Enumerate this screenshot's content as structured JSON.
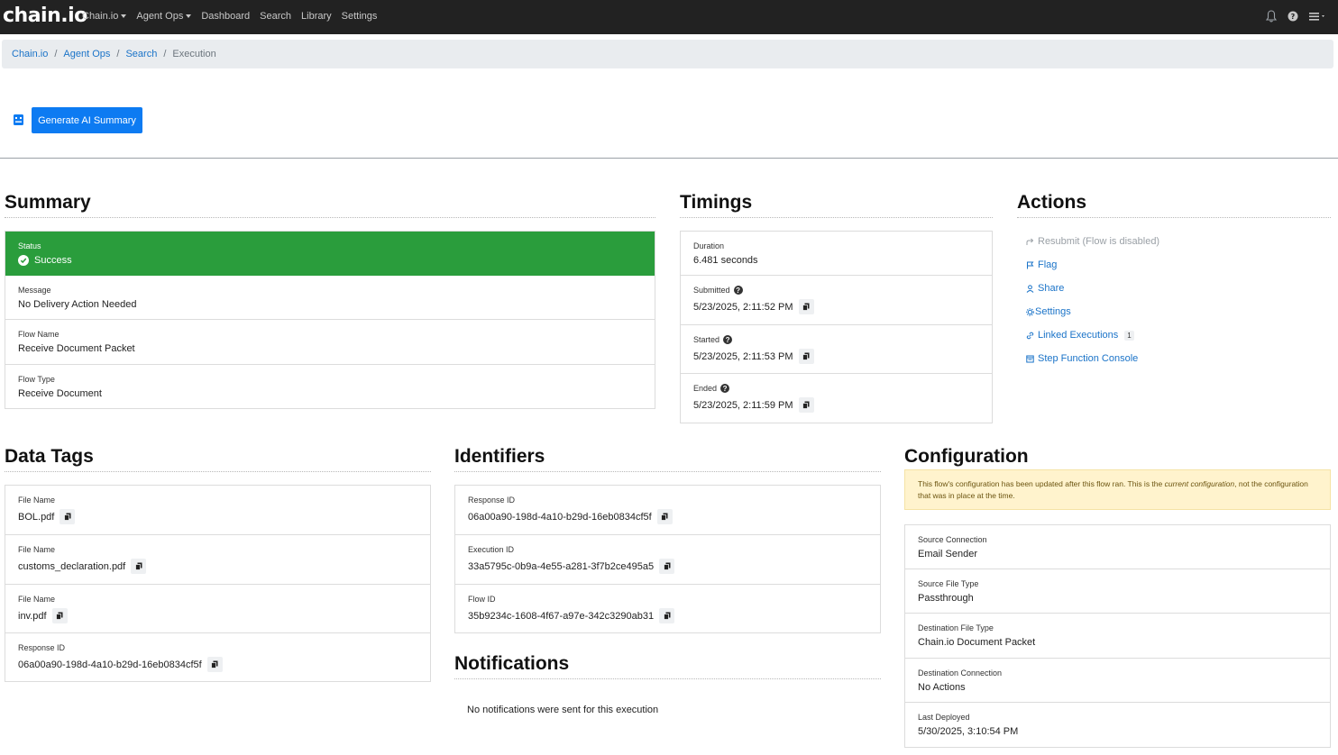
{
  "nav": {
    "brand": "chain.io",
    "links": [
      {
        "label": "Chain.io",
        "dropdown": true
      },
      {
        "label": "Agent Ops",
        "dropdown": true
      },
      {
        "label": "Dashboard",
        "dropdown": false
      },
      {
        "label": "Search",
        "dropdown": false
      },
      {
        "label": "Library",
        "dropdown": false
      },
      {
        "label": "Settings",
        "dropdown": false
      }
    ],
    "right_icons": [
      "bell-icon",
      "help-icon",
      "menu-icon"
    ]
  },
  "breadcrumb": {
    "items": [
      "Chain.io",
      "Agent Ops",
      "Search"
    ],
    "current": "Execution"
  },
  "ai": {
    "button_label": "Generate AI Summary"
  },
  "summary": {
    "title": "Summary",
    "status_label": "Status",
    "status_value": "Success",
    "rows": [
      {
        "label": "Message",
        "value": "No Delivery Action Needed"
      },
      {
        "label": "Flow Name",
        "value": "Receive Document Packet"
      },
      {
        "label": "Flow Type",
        "value": "Receive Document"
      }
    ]
  },
  "timings": {
    "title": "Timings",
    "duration_label": "Duration",
    "duration_value": "6.481 seconds",
    "rows": [
      {
        "label": "Submitted",
        "value": "5/23/2025, 2:11:52 PM"
      },
      {
        "label": "Started",
        "value": "5/23/2025, 2:11:53 PM"
      },
      {
        "label": "Ended",
        "value": "5/23/2025, 2:11:59 PM"
      }
    ]
  },
  "actions": {
    "title": "Actions",
    "items": [
      {
        "label": "Resubmit (Flow is disabled)",
        "icon": "share-arrow-icon",
        "disabled": true
      },
      {
        "label": "Flag",
        "icon": "flag-icon",
        "disabled": false
      },
      {
        "label": "Share",
        "icon": "person-icon",
        "disabled": false
      },
      {
        "label": "Settings",
        "icon": "gear-icon",
        "disabled": false
      },
      {
        "label": "Linked Executions",
        "icon": "link-icon",
        "disabled": false,
        "badge": "1"
      },
      {
        "label": "Step Function Console",
        "icon": "console-icon",
        "disabled": false
      }
    ]
  },
  "data_tags": {
    "title": "Data Tags",
    "rows": [
      {
        "label": "File Name",
        "value": "BOL.pdf"
      },
      {
        "label": "File Name",
        "value": "customs_declaration.pdf"
      },
      {
        "label": "File Name",
        "value": "inv.pdf"
      },
      {
        "label": "Response ID",
        "value": "06a00a90-198d-4a10-b29d-16eb0834cf5f"
      }
    ]
  },
  "identifiers": {
    "title": "Identifiers",
    "rows": [
      {
        "label": "Response ID",
        "value": "06a00a90-198d-4a10-b29d-16eb0834cf5f"
      },
      {
        "label": "Execution ID",
        "value": "33a5795c-0b9a-4e55-a281-3f7b2ce495a5"
      },
      {
        "label": "Flow ID",
        "value": "35b9234c-1608-4f67-a97e-342c3290ab31"
      }
    ]
  },
  "notifications": {
    "title": "Notifications",
    "empty_text": "No notifications were sent for this execution"
  },
  "configuration": {
    "title": "Configuration",
    "alert_pre": "This flow's configuration has been updated after this flow ran. This is the ",
    "alert_em": "current configuration",
    "alert_post": ", not the configuration that was in place at the time.",
    "rows": [
      {
        "label": "Source Connection",
        "value": "Email Sender"
      },
      {
        "label": "Source File Type",
        "value": "Passthrough"
      },
      {
        "label": "Destination File Type",
        "value": "Chain.io Document Packet"
      },
      {
        "label": "Destination Connection",
        "value": "No Actions"
      },
      {
        "label": "Last Deployed",
        "value": "5/30/2025, 3:10:54 PM"
      }
    ]
  },
  "colors": {
    "navbar": "#222222",
    "success": "#2a9d3c",
    "primary": "#0d7bf2",
    "link": "#1a73c8",
    "alert_bg": "#fff3cd"
  }
}
